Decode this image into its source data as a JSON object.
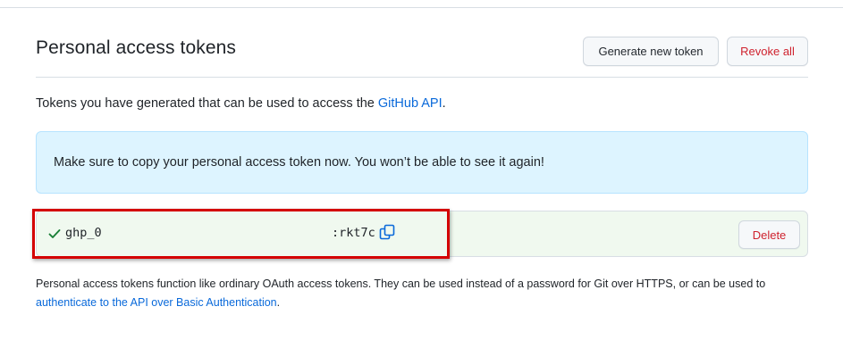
{
  "header": {
    "title": "Personal access tokens",
    "generate_label": "Generate new token",
    "revoke_label": "Revoke all"
  },
  "intro": {
    "text": "Tokens you have generated that can be used to access the ",
    "link": "GitHub API",
    "suffix": "."
  },
  "flash": {
    "message": "Make sure to copy your personal access token now. You won’t be able to see it again!"
  },
  "token": {
    "prefix": "ghp_0",
    "suffix": ":rkt7c",
    "delete_label": "Delete",
    "status_icon": "check-icon",
    "copy_icon": "copy-icon"
  },
  "footnote": {
    "text": "Personal access tokens function like ordinary OAuth access tokens. They can be used instead of a password for Git over HTTPS, or can be used to ",
    "link": "authenticate to the API over Basic Authentication",
    "suffix": "."
  },
  "colors": {
    "accent": "#0969da",
    "danger": "#cf222e",
    "success": "#1a7f37",
    "flash_bg": "#ddf4ff",
    "token_bg": "#f0f9ef",
    "annotation": "#d40000"
  }
}
